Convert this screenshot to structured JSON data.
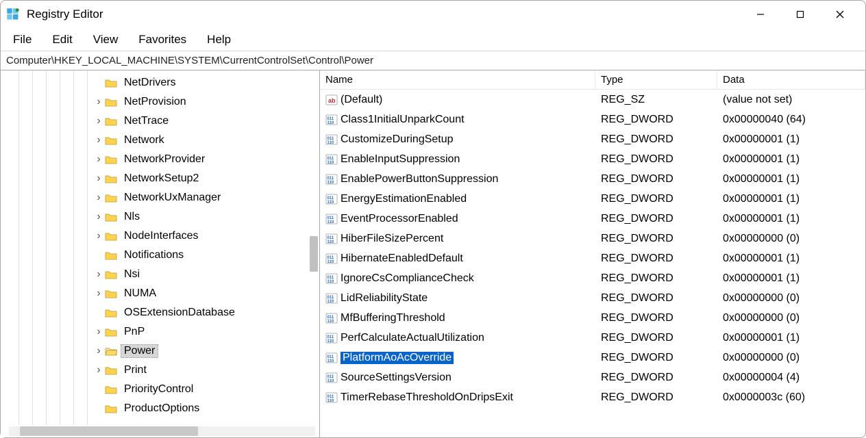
{
  "app": {
    "title": "Registry Editor"
  },
  "menu": {
    "file": "File",
    "edit": "Edit",
    "view": "View",
    "favorites": "Favorites",
    "help": "Help"
  },
  "address": "Computer\\HKEY_LOCAL_MACHINE\\SYSTEM\\CurrentControlSet\\Control\\Power",
  "list_header": {
    "name": "Name",
    "type": "Type",
    "data": "Data"
  },
  "tree": {
    "items": [
      {
        "label": "NetDrivers",
        "expander": ""
      },
      {
        "label": "NetProvision",
        "expander": ">"
      },
      {
        "label": "NetTrace",
        "expander": ">"
      },
      {
        "label": "Network",
        "expander": ">"
      },
      {
        "label": "NetworkProvider",
        "expander": ">"
      },
      {
        "label": "NetworkSetup2",
        "expander": ">"
      },
      {
        "label": "NetworkUxManager",
        "expander": ">"
      },
      {
        "label": "Nls",
        "expander": ">"
      },
      {
        "label": "NodeInterfaces",
        "expander": ">"
      },
      {
        "label": "Notifications",
        "expander": ""
      },
      {
        "label": "Nsi",
        "expander": ">"
      },
      {
        "label": "NUMA",
        "expander": ">"
      },
      {
        "label": "OSExtensionDatabase",
        "expander": ""
      },
      {
        "label": "PnP",
        "expander": ">"
      },
      {
        "label": "Power",
        "expander": ">",
        "selected": true,
        "open": true
      },
      {
        "label": "Print",
        "expander": ">"
      },
      {
        "label": "PriorityControl",
        "expander": ""
      },
      {
        "label": "ProductOptions",
        "expander": ""
      }
    ]
  },
  "values": [
    {
      "icon": "str",
      "name": "(Default)",
      "type": "REG_SZ",
      "data": "(value not set)"
    },
    {
      "icon": "bin",
      "name": "Class1InitialUnparkCount",
      "type": "REG_DWORD",
      "data": "0x00000040 (64)"
    },
    {
      "icon": "bin",
      "name": "CustomizeDuringSetup",
      "type": "REG_DWORD",
      "data": "0x00000001 (1)"
    },
    {
      "icon": "bin",
      "name": "EnableInputSuppression",
      "type": "REG_DWORD",
      "data": "0x00000001 (1)"
    },
    {
      "icon": "bin",
      "name": "EnablePowerButtonSuppression",
      "type": "REG_DWORD",
      "data": "0x00000001 (1)"
    },
    {
      "icon": "bin",
      "name": "EnergyEstimationEnabled",
      "type": "REG_DWORD",
      "data": "0x00000001 (1)"
    },
    {
      "icon": "bin",
      "name": "EventProcessorEnabled",
      "type": "REG_DWORD",
      "data": "0x00000001 (1)"
    },
    {
      "icon": "bin",
      "name": "HiberFileSizePercent",
      "type": "REG_DWORD",
      "data": "0x00000000 (0)"
    },
    {
      "icon": "bin",
      "name": "HibernateEnabledDefault",
      "type": "REG_DWORD",
      "data": "0x00000001 (1)"
    },
    {
      "icon": "bin",
      "name": "IgnoreCsComplianceCheck",
      "type": "REG_DWORD",
      "data": "0x00000001 (1)"
    },
    {
      "icon": "bin",
      "name": "LidReliabilityState",
      "type": "REG_DWORD",
      "data": "0x00000000 (0)"
    },
    {
      "icon": "bin",
      "name": "MfBufferingThreshold",
      "type": "REG_DWORD",
      "data": "0x00000000 (0)"
    },
    {
      "icon": "bin",
      "name": "PerfCalculateActualUtilization",
      "type": "REG_DWORD",
      "data": "0x00000001 (1)"
    },
    {
      "icon": "bin",
      "name": "PlatformAoAcOverride",
      "type": "REG_DWORD",
      "data": "0x00000000 (0)",
      "selected": true
    },
    {
      "icon": "bin",
      "name": "SourceSettingsVersion",
      "type": "REG_DWORD",
      "data": "0x00000004 (4)"
    },
    {
      "icon": "bin",
      "name": "TimerRebaseThresholdOnDripsExit",
      "type": "REG_DWORD",
      "data": "0x0000003c (60)"
    }
  ]
}
